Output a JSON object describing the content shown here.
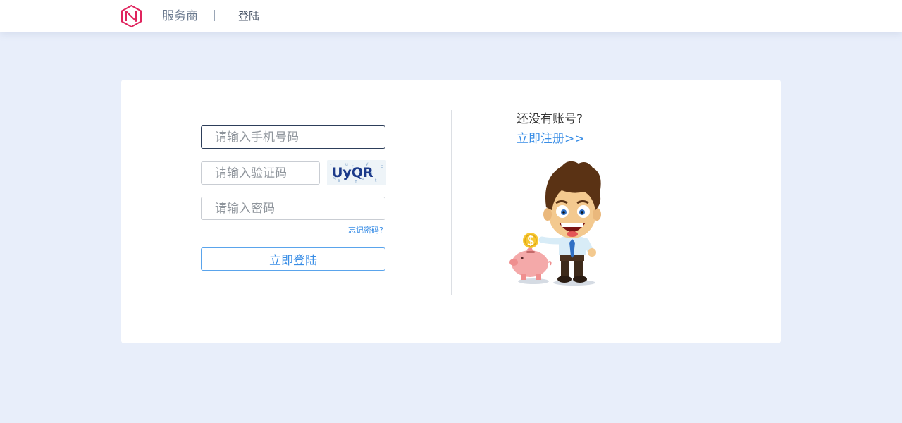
{
  "header": {
    "service_label": "服务商",
    "login_label": "登陆"
  },
  "form": {
    "phone_placeholder": "请输入手机号码",
    "captcha_placeholder": "请输入验证码",
    "captcha_text": "UyQR",
    "password_placeholder": "请输入密码",
    "forgot_label": "忘记密码?",
    "login_button_label": "立即登陆"
  },
  "side": {
    "no_account_label": "还没有账号?",
    "register_label": "立即注册>>"
  },
  "colors": {
    "page_bg": "#e8eefa",
    "logo": "#e0245e",
    "link": "#3a8ee6",
    "captcha_text": "#1c3a8a"
  }
}
